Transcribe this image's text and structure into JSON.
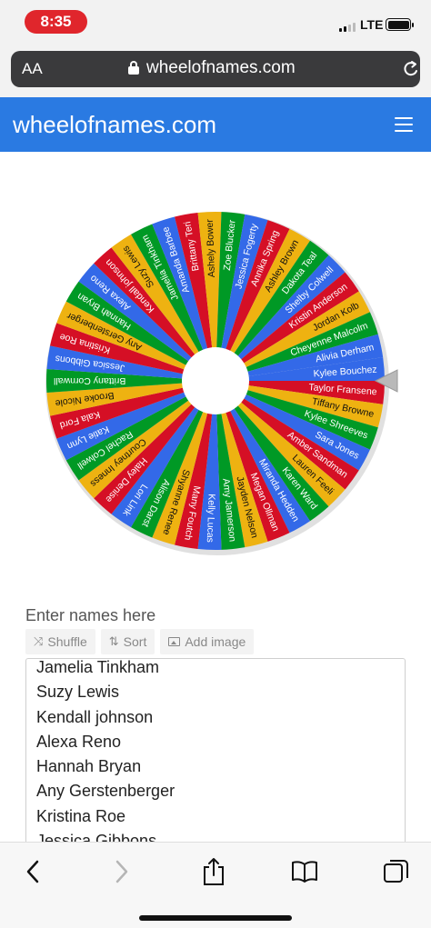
{
  "status_bar": {
    "time": "8:35",
    "network": "LTE"
  },
  "browser": {
    "aa_label": "AA",
    "url": "wheelofnames.com"
  },
  "site": {
    "title": "wheelofnames.com"
  },
  "wheel": {
    "colors": [
      "#3369e8",
      "#d50f25",
      "#eeb211",
      "#009925"
    ],
    "pointer_color": "#b9b9b9",
    "segments": [
      "Kylee Bouchez",
      "Taylor Fransene",
      "Tiffany Browne",
      "Kylee Shreeves",
      "Sara Jones",
      "Amber Sandman",
      "Lauren Feeli",
      "Karen Ward",
      "Miranda Hedden",
      "Megan Ollman",
      "Jayden Nelson",
      "Amy Jamerson",
      "Kelly Lucas",
      "Many Foutch",
      "Shyanne Renee",
      "Alison Darst",
      "Lori Link",
      "Haley Denise",
      "Courtney Inness",
      "Rachel Colwell",
      "Katie Lynn",
      "Kala Ford",
      "Brooke Nicole",
      "Brittany Cornwall",
      "Jessica Gibbons",
      "Kristina Roe",
      "Any Gerstenberger",
      "Hannah Bryan",
      "Alexa Reno",
      "Kendall johnson",
      "Suzy Lewis",
      "Jamelia Tinkham",
      "Amanda Barbee",
      "Brittany Teri",
      "Ashely Bower",
      "Zoe Blucker",
      "Jessica Fogerty",
      "Annika Spring",
      "Ashley Brown",
      "Dakota Teal",
      "Shelby Colwell",
      "Kristin Anderson",
      "Jordan Kolb",
      "Cheyenne Malcolm",
      "Alivia Derham"
    ]
  },
  "editor": {
    "label": "Enter names here",
    "shuffle_label": "Shuffle",
    "sort_label": "Sort",
    "add_image_label": "Add image",
    "names": [
      "Jamelia Tinkham",
      "Suzy Lewis",
      "Kendall johnson",
      "Alexa Reno",
      "Hannah Bryan",
      "Any Gerstenberger",
      "Kristina Roe",
      "Jessica Gibbons"
    ]
  }
}
